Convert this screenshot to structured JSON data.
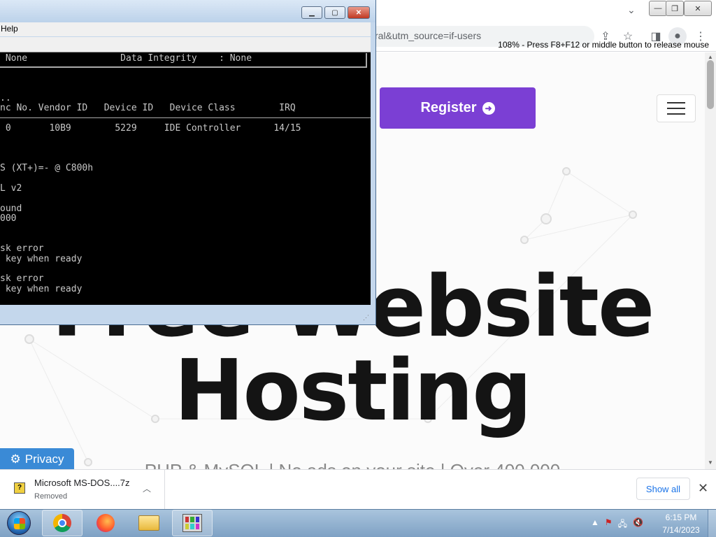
{
  "browser": {
    "address_text": "ral&utm_source=if-users",
    "tab_dropdown": "⌄"
  },
  "page": {
    "register_label": "Register",
    "hero_line1": "Free Website",
    "hero_line2": "Hosting",
    "hero_sub": "PHP & MySQL | No ads on your site | Over 400,000",
    "privacy_label": "Privacy"
  },
  "downloads": {
    "file_name": "Microsoft MS-DOS....7z",
    "status": "Removed",
    "show_all_label": "Show all"
  },
  "taskbar": {
    "time": "6:15 PM",
    "date": "7/14/2023"
  },
  "dos_window": {
    "menu_help": "Help",
    "status_text": "108% - Press F8+F12 or middle button to release mouse",
    "screen_lines": [
      " None                 Data Integrity    : None",
      "",
      "..",
      "nc No. Vendor ID   Device ID   Device Class        IRQ",
      "",
      " 0       10B9        5229     IDE Controller      14/15",
      "",
      "",
      "S (XT+)=- @ C800h",
      "",
      "L v2",
      "",
      "ound",
      "000",
      "",
      "",
      "sk error",
      " key when ready",
      "",
      "sk error",
      " key when ready"
    ]
  }
}
